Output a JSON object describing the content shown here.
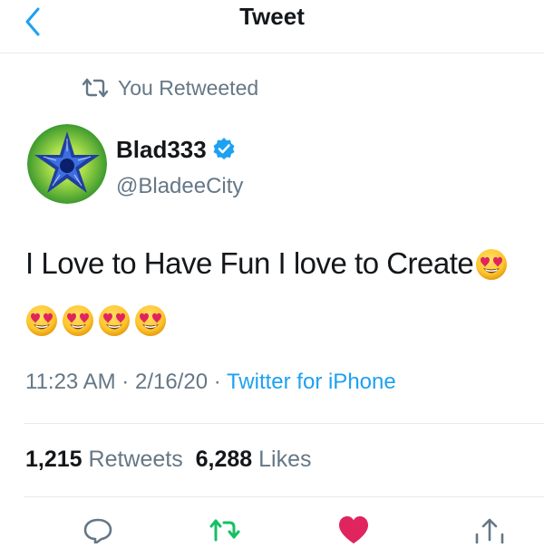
{
  "header": {
    "title": "Tweet",
    "back_icon": "chevron-left-icon"
  },
  "context": {
    "icon": "retweet-icon",
    "text": "You Retweeted"
  },
  "author": {
    "name": "Blad333",
    "handle": "@BladeeCity",
    "verified": true,
    "avatar_icon": "blue-star-avatar"
  },
  "tweet": {
    "text": "I Love to Have Fun I love to Create",
    "emoji_count_inline": 1,
    "emoji_row_count": 4,
    "emoji_name": "heart-eyes-emoji"
  },
  "meta": {
    "time": "11:23 AM",
    "separator": "·",
    "date": "2/16/20",
    "source": "Twitter for iPhone"
  },
  "stats": {
    "retweets_count": "1,215",
    "retweets_label": "Retweets",
    "likes_count": "6,288",
    "likes_label": "Likes"
  },
  "actions": [
    {
      "name": "reply",
      "icon": "reply-icon"
    },
    {
      "name": "retweet",
      "icon": "retweet-icon",
      "active_color": "#17bf63"
    },
    {
      "name": "like",
      "icon": "heart-icon",
      "active_color": "#e0245e"
    },
    {
      "name": "share",
      "icon": "share-icon"
    }
  ],
  "colors": {
    "accent": "#1da1f2",
    "muted": "#657786",
    "retweet": "#17bf63",
    "like": "#e0245e"
  }
}
